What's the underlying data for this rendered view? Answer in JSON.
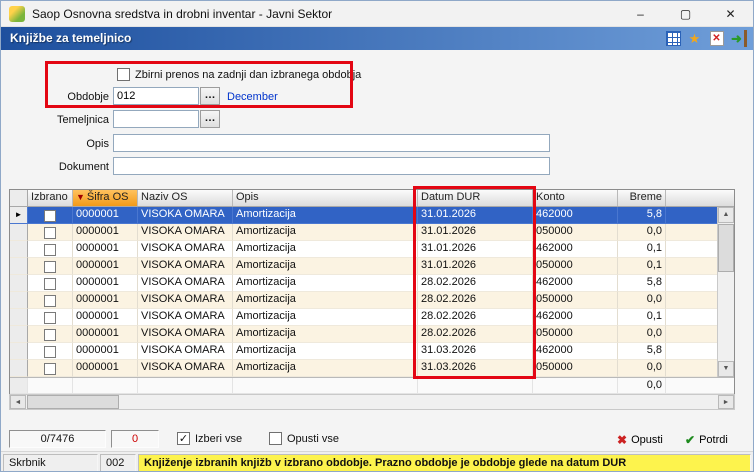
{
  "window": {
    "title": "Saop Osnovna sredstva in drobni inventar - Javni Sektor"
  },
  "header": {
    "title": "Knjižbe za temeljnico"
  },
  "form": {
    "zbirni_label": "Zbirni prenos na zadnji dan izbranega obdobja",
    "obdobje": {
      "label": "Obdobje",
      "value": "012",
      "month": "December"
    },
    "temeljnica": {
      "label": "Temeljnica",
      "value": ""
    },
    "opis": {
      "label": "Opis",
      "value": ""
    },
    "dokument": {
      "label": "Dokument",
      "value": ""
    }
  },
  "table": {
    "headers": {
      "izbrano": "Izbrano",
      "sifra": "Šifra OS",
      "naziv": "Naziv OS",
      "opis": "Opis",
      "datum": "Datum DUR",
      "konto": "Konto",
      "breme": "Breme"
    },
    "rows": [
      {
        "sifra": "0000001",
        "naziv": "VISOKA OMARA",
        "opis": "Amortizacija",
        "datum": "31.01.2026",
        "konto": "462000",
        "breme": "5,8"
      },
      {
        "sifra": "0000001",
        "naziv": "VISOKA OMARA",
        "opis": "Amortizacija",
        "datum": "31.01.2026",
        "konto": "050000",
        "breme": "0,0"
      },
      {
        "sifra": "0000001",
        "naziv": "VISOKA OMARA",
        "opis": "Amortizacija",
        "datum": "31.01.2026",
        "konto": "462000",
        "breme": "0,1"
      },
      {
        "sifra": "0000001",
        "naziv": "VISOKA OMARA",
        "opis": "Amortizacija",
        "datum": "31.01.2026",
        "konto": "050000",
        "breme": "0,1"
      },
      {
        "sifra": "0000001",
        "naziv": "VISOKA OMARA",
        "opis": "Amortizacija",
        "datum": "28.02.2026",
        "konto": "462000",
        "breme": "5,8"
      },
      {
        "sifra": "0000001",
        "naziv": "VISOKA OMARA",
        "opis": "Amortizacija",
        "datum": "28.02.2026",
        "konto": "050000",
        "breme": "0,0"
      },
      {
        "sifra": "0000001",
        "naziv": "VISOKA OMARA",
        "opis": "Amortizacija",
        "datum": "28.02.2026",
        "konto": "462000",
        "breme": "0,1"
      },
      {
        "sifra": "0000001",
        "naziv": "VISOKA OMARA",
        "opis": "Amortizacija",
        "datum": "28.02.2026",
        "konto": "050000",
        "breme": "0,0"
      },
      {
        "sifra": "0000001",
        "naziv": "VISOKA OMARA",
        "opis": "Amortizacija",
        "datum": "31.03.2026",
        "konto": "462000",
        "breme": "5,8"
      },
      {
        "sifra": "0000001",
        "naziv": "VISOKA OMARA",
        "opis": "Amortizacija",
        "datum": "31.03.2026",
        "konto": "050000",
        "breme": "0,0"
      }
    ],
    "sum": "0,0"
  },
  "footer": {
    "counter": "0/7476",
    "selected_count": "0",
    "izberi_vse": "Izberi vse",
    "opusti_vse": "Opusti vse",
    "opusti": "Opusti",
    "potrdi": "Potrdi"
  },
  "statusbar": {
    "user": "Skrbnik",
    "code": "002",
    "message": "Knjiženje izbranih knjižb v izbrano obdobje. Prazno obdobje je obdobje glede na datum DUR"
  },
  "icons": {
    "minimize": "–",
    "maximize": "▢",
    "close": "✕",
    "ellipsis": "…",
    "sort_desc": "▼",
    "row_marker": "►",
    "check": "✓",
    "star": "★",
    "exit_arrow": "➜",
    "doc_x": "✕",
    "opusti_x": "✖",
    "potrdi_check": "✔",
    "scroll_up": "▲",
    "scroll_down": "▼",
    "scroll_left": "◄",
    "scroll_right": "►"
  },
  "colors": {
    "annotation_red": "#e30613",
    "selection_blue": "#3163c5",
    "header_orange_top": "#ffc25e",
    "header_orange_bottom": "#f29a1a",
    "status_yellow": "#fdf34d",
    "link_blue": "#0033cc",
    "counter_red": "#cc0000",
    "row_cream": "#fbf3e2",
    "header_blue_left": "#1d4f9e",
    "header_blue_right": "#6f9ed9"
  }
}
